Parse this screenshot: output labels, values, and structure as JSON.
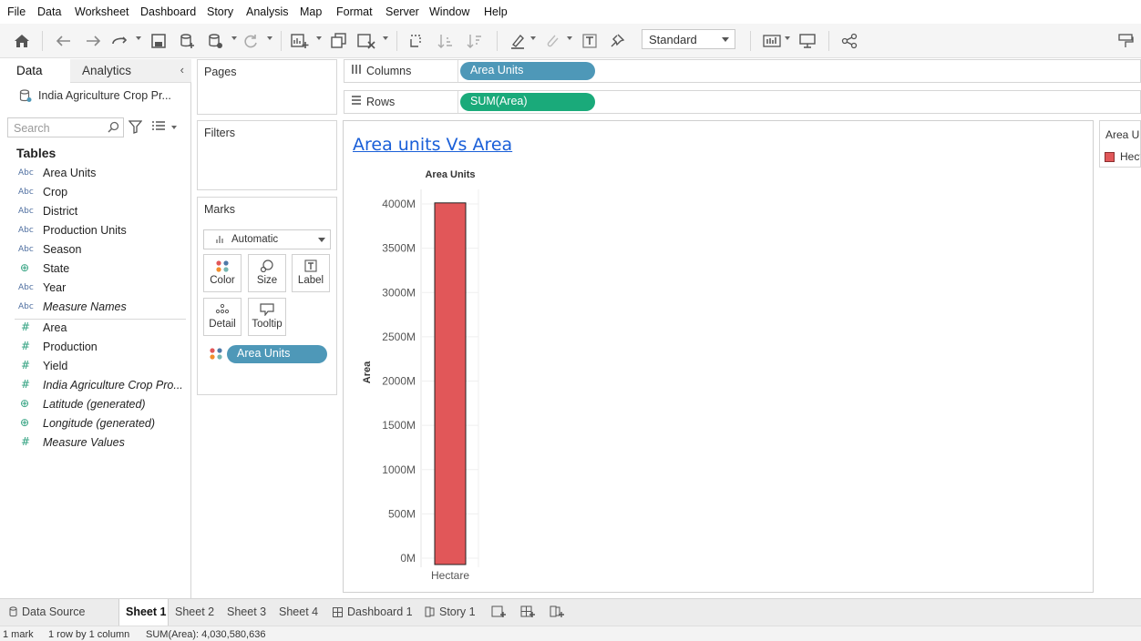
{
  "menu": [
    "File",
    "Data",
    "Worksheet",
    "Dashboard",
    "Story",
    "Analysis",
    "Map",
    "Format",
    "Server",
    "Window",
    "Help"
  ],
  "toolbar": {
    "show_me_label": "Standard"
  },
  "data_pane": {
    "tab_data": "Data",
    "tab_analytics": "Analytics",
    "datasource": "India Agriculture Crop Pr...",
    "search_placeholder": "Search",
    "tables_heading": "Tables",
    "dimensions": [
      {
        "icon": "abc",
        "label": "Area Units"
      },
      {
        "icon": "abc",
        "label": "Crop"
      },
      {
        "icon": "abc",
        "label": "District"
      },
      {
        "icon": "abc",
        "label": "Production Units"
      },
      {
        "icon": "abc",
        "label": "Season"
      },
      {
        "icon": "globe",
        "label": "State"
      },
      {
        "icon": "abc",
        "label": "Year"
      },
      {
        "icon": "abc",
        "label": "Measure Names"
      }
    ],
    "measures": [
      {
        "icon": "hash",
        "label": "Area"
      },
      {
        "icon": "hash",
        "label": "Production"
      },
      {
        "icon": "hash",
        "label": "Yield"
      },
      {
        "icon": "hash",
        "label": "India Agriculture Crop Pro..."
      },
      {
        "icon": "globe",
        "label": "Latitude (generated)"
      },
      {
        "icon": "globe",
        "label": "Longitude (generated)"
      },
      {
        "icon": "hash",
        "label": "Measure Values"
      }
    ]
  },
  "cards": {
    "pages": "Pages",
    "filters": "Filters",
    "marks": "Marks",
    "mark_type": "Automatic",
    "buttons": [
      "Color",
      "Size",
      "Label",
      "Detail",
      "Tooltip"
    ],
    "color_pill": "Area Units"
  },
  "shelves": {
    "columns_label": "Columns",
    "columns_pill": "Area Units",
    "rows_label": "Rows",
    "rows_pill": "SUM(Area)"
  },
  "view": {
    "title": "Area units Vs Area"
  },
  "legend": {
    "title": "Area Units",
    "item": "Hectare",
    "color": "#e15759"
  },
  "chart_data": {
    "type": "bar",
    "title": "Area units Vs Area",
    "column_header": "Area Units",
    "categories": [
      "Hectare"
    ],
    "values": [
      4030580636
    ],
    "ylabel": "Area",
    "ylim": [
      0,
      4000000000
    ],
    "yticks": [
      "0M",
      "500M",
      "1000M",
      "1500M",
      "2000M",
      "2500M",
      "3000M",
      "3500M",
      "4000M"
    ],
    "ytick_values": [
      0,
      500000000,
      1000000000,
      1500000000,
      2000000000,
      2500000000,
      3000000000,
      3500000000,
      4000000000
    ],
    "bar_color": "#e15759",
    "grid": true
  },
  "tabs": {
    "data_source": "Data Source",
    "sheets": [
      "Sheet 1",
      "Sheet 2",
      "Sheet 3",
      "Sheet 4"
    ],
    "dashboard": "Dashboard 1",
    "story": "Story 1"
  },
  "status": {
    "marks": "1 mark",
    "rows": "1 row by 1 column",
    "sum": "SUM(Area): 4,030,580,636"
  },
  "colors": {
    "columns_pill": "#4e98b8",
    "rows_pill": "#1aaa7a",
    "title_link": "#1a5fd8"
  }
}
